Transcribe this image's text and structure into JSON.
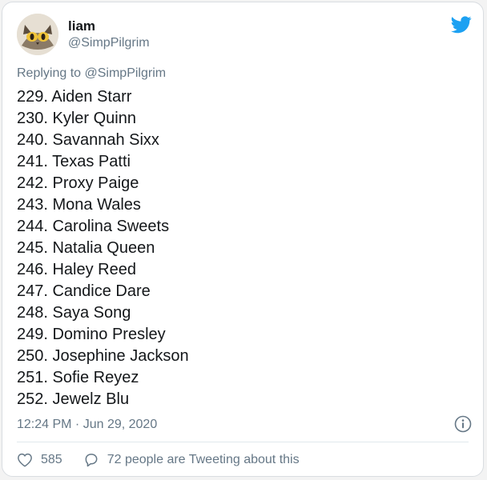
{
  "tweet": {
    "author_name": "liam",
    "author_handle": "@SimpPilgrim",
    "replying_prefix": "Replying to",
    "replying_to": "@SimpPilgrim",
    "lines": [
      "229. Aiden Starr",
      "230. Kyler Quinn",
      "240. Savannah Sixx",
      "241. Texas Patti",
      "242. Proxy Paige",
      "243. Mona Wales",
      "244. Carolina Sweets",
      "245. Natalia Queen",
      "246. Haley Reed",
      "247. Candice Dare",
      "248. Saya Song",
      "249. Domino Presley",
      "250. Josephine Jackson",
      "251. Sofie Reyez",
      "252. Jewelz Blu"
    ],
    "timestamp": "12:24 PM · Jun 29, 2020",
    "likes": "585",
    "conversation": "72 people are Tweeting about this"
  },
  "icons": {
    "brand": "twitter-bird-icon",
    "info": "info-icon",
    "like": "heart-icon",
    "conversation": "speech-bubble-icon"
  },
  "colors": {
    "brand": "#1da1f2",
    "text": "#14171a",
    "muted": "#657786"
  }
}
